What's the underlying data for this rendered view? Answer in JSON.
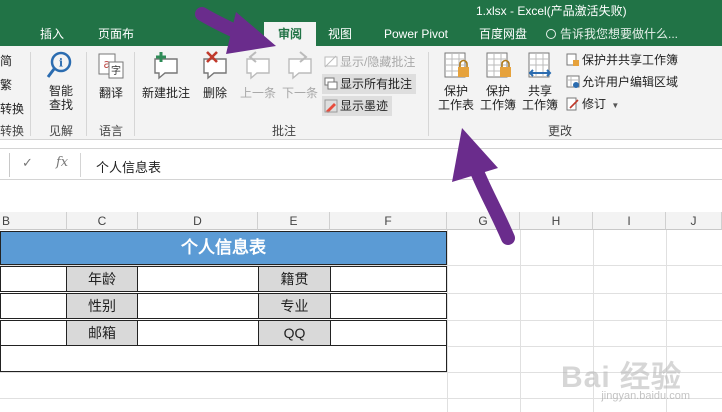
{
  "window": {
    "title": "1.xlsx - Excel(产品激活失败)"
  },
  "tabs": [
    {
      "label": "插入",
      "active": false
    },
    {
      "label": "页面布",
      "active": false
    },
    {
      "label": "审阅",
      "active": true
    },
    {
      "label": "视图",
      "active": false
    },
    {
      "label": "Power Pivot",
      "active": false
    },
    {
      "label": "百度网盘",
      "active": false
    }
  ],
  "tellme": {
    "text": "告诉我您想要做什么..."
  },
  "ribbon": {
    "left_fragments": [
      "简",
      "繁",
      "转换",
      "转换"
    ],
    "insight": {
      "smart_lookup": "智能\n查找",
      "group": "见解"
    },
    "language": {
      "translate": "翻译",
      "group": "语言"
    },
    "comments": {
      "new": "新建批注",
      "delete": "删除",
      "previous": "上一条",
      "next": "下一条",
      "show_hide": "显示/隐藏批注",
      "show_all": "显示所有批注",
      "show_ink": "显示墨迹",
      "group": "批注"
    },
    "changes": {
      "protect_sheet": "保护\n工作表",
      "protect_workbook": "保护\n工作簿",
      "share_workbook": "共享\n工作簿",
      "protect_share": "保护并共享工作簿",
      "allow_edit": "允许用户编辑区域",
      "track_changes": "修订",
      "group": "更改"
    }
  },
  "formula_bar": {
    "cancel": "✓",
    "fx": "fx",
    "content": "个人信息表"
  },
  "columns": [
    "B",
    "C",
    "D",
    "E",
    "F",
    "G",
    "H",
    "I",
    "J"
  ],
  "sheet": {
    "title": "个人信息表",
    "labels_left": [
      "年龄",
      "性别",
      "邮箱"
    ],
    "labels_right": [
      "籍贯",
      "专业",
      "QQ"
    ]
  },
  "watermark": {
    "brand": "Bai 经验",
    "url": "jingyan.baidu.com"
  },
  "colors": {
    "excel_green": "#217346",
    "arrow_purple": "#6a2c8c",
    "title_fill": "#5b9bd5",
    "label_fill": "#d9d9d9"
  }
}
